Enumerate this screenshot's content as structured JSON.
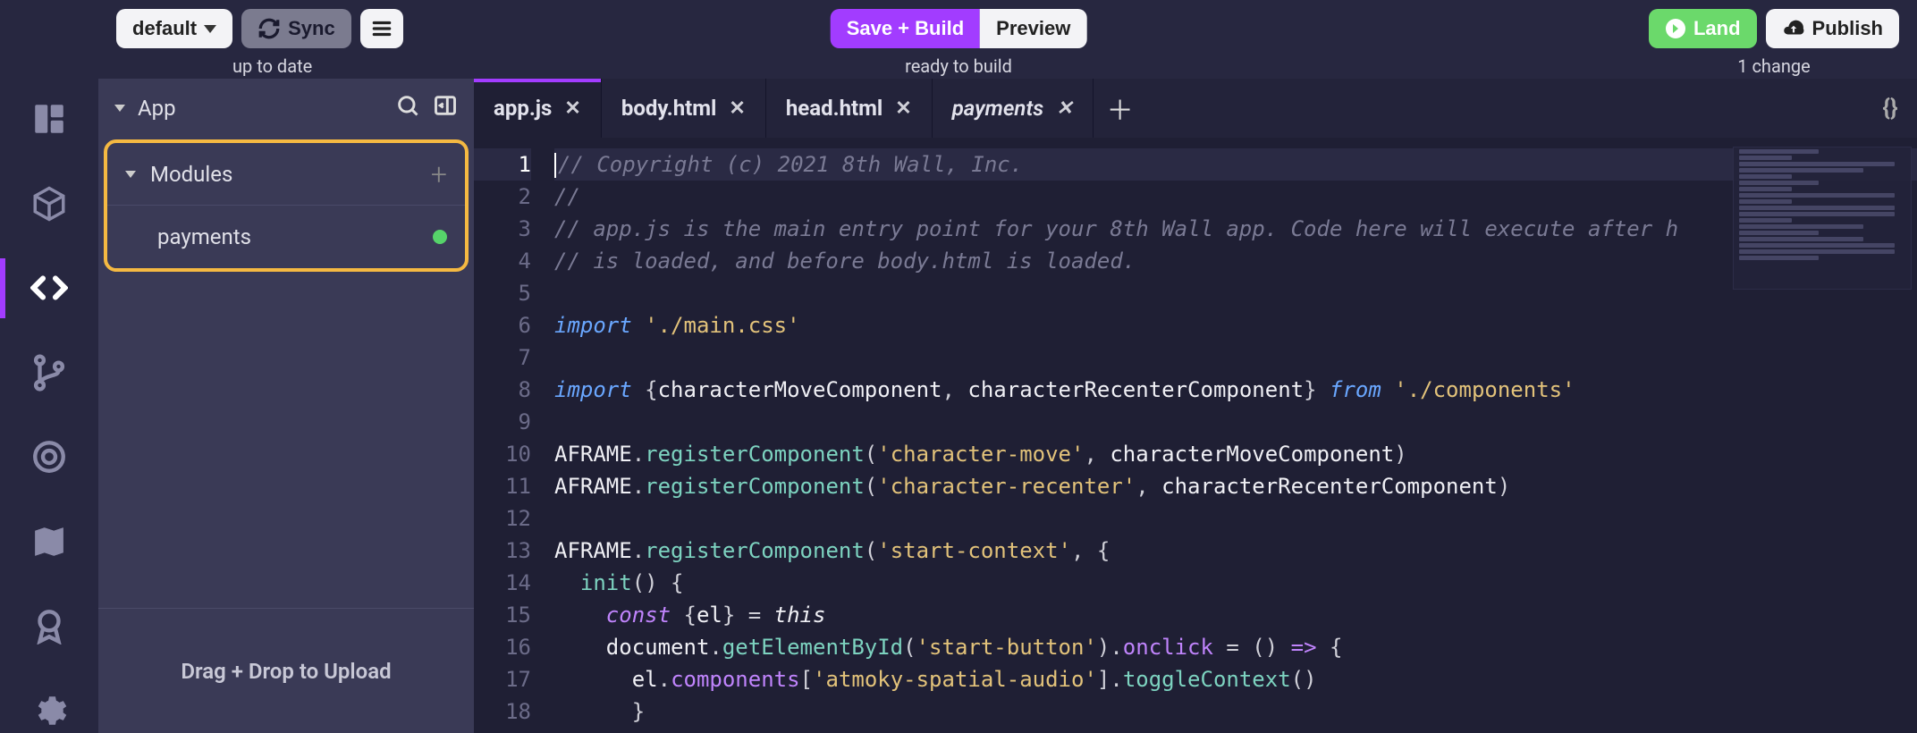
{
  "topbar": {
    "branch_label": "default",
    "sync_label": "Sync",
    "sync_status": "up to date",
    "save_build_label": "Save + Build",
    "preview_label": "Preview",
    "build_status": "ready to build",
    "land_label": "Land",
    "publish_label": "Publish",
    "changes_status": "1 change"
  },
  "rail": {
    "items": [
      {
        "name": "layout-icon"
      },
      {
        "name": "cube-icon"
      },
      {
        "name": "code-icon"
      },
      {
        "name": "branch-icon"
      },
      {
        "name": "target-icon"
      },
      {
        "name": "map-icon"
      },
      {
        "name": "award-icon"
      },
      {
        "name": "gear-icon"
      }
    ],
    "active_index": 2
  },
  "filepanel": {
    "root_label": "App",
    "section_label": "Modules",
    "items": [
      {
        "label": "payments",
        "status": "modified"
      }
    ],
    "drop_hint": "Drag + Drop to Upload"
  },
  "tabs": {
    "items": [
      {
        "label": "app.js",
        "active": true,
        "italic": false
      },
      {
        "label": "body.html",
        "active": false,
        "italic": false
      },
      {
        "label": "head.html",
        "active": false,
        "italic": false
      },
      {
        "label": "payments",
        "active": false,
        "italic": true
      }
    ]
  },
  "editor": {
    "active_line": 1,
    "lines": [
      {
        "n": 1,
        "tokens": [
          {
            "t": "comment",
            "v": "// Copyright (c) 2021 8th Wall, Inc."
          }
        ]
      },
      {
        "n": 2,
        "tokens": [
          {
            "t": "comment",
            "v": "//"
          }
        ]
      },
      {
        "n": 3,
        "tokens": [
          {
            "t": "comment",
            "v": "// app.js is the main entry point for your 8th Wall app. Code here will execute after h"
          }
        ]
      },
      {
        "n": 4,
        "tokens": [
          {
            "t": "comment",
            "v": "// is loaded, and before body.html is loaded."
          }
        ]
      },
      {
        "n": 5,
        "tokens": []
      },
      {
        "n": 6,
        "tokens": [
          {
            "t": "kw",
            "v": "import"
          },
          {
            "t": "punc",
            "v": " "
          },
          {
            "t": "str",
            "v": "'./main.css'"
          }
        ]
      },
      {
        "n": 7,
        "tokens": []
      },
      {
        "n": 8,
        "tokens": [
          {
            "t": "kw",
            "v": "import"
          },
          {
            "t": "punc",
            "v": " {"
          },
          {
            "t": "ident",
            "v": "characterMoveComponent"
          },
          {
            "t": "punc",
            "v": ", "
          },
          {
            "t": "ident",
            "v": "characterRecenterComponent"
          },
          {
            "t": "punc",
            "v": "} "
          },
          {
            "t": "kw",
            "v": "from"
          },
          {
            "t": "punc",
            "v": " "
          },
          {
            "t": "str",
            "v": "'./components'"
          }
        ]
      },
      {
        "n": 9,
        "tokens": []
      },
      {
        "n": 10,
        "tokens": [
          {
            "t": "type",
            "v": "AFRAME"
          },
          {
            "t": "punc",
            "v": "."
          },
          {
            "t": "func",
            "v": "registerComponent"
          },
          {
            "t": "punc",
            "v": "("
          },
          {
            "t": "str",
            "v": "'character-move'"
          },
          {
            "t": "punc",
            "v": ", "
          },
          {
            "t": "ident",
            "v": "characterMoveComponent"
          },
          {
            "t": "punc",
            "v": ")"
          }
        ]
      },
      {
        "n": 11,
        "tokens": [
          {
            "t": "type",
            "v": "AFRAME"
          },
          {
            "t": "punc",
            "v": "."
          },
          {
            "t": "func",
            "v": "registerComponent"
          },
          {
            "t": "punc",
            "v": "("
          },
          {
            "t": "str",
            "v": "'character-recenter'"
          },
          {
            "t": "punc",
            "v": ", "
          },
          {
            "t": "ident",
            "v": "characterRecenterComponent"
          },
          {
            "t": "punc",
            "v": ")"
          }
        ]
      },
      {
        "n": 12,
        "tokens": []
      },
      {
        "n": 13,
        "tokens": [
          {
            "t": "type",
            "v": "AFRAME"
          },
          {
            "t": "punc",
            "v": "."
          },
          {
            "t": "func",
            "v": "registerComponent"
          },
          {
            "t": "punc",
            "v": "("
          },
          {
            "t": "str",
            "v": "'start-context'"
          },
          {
            "t": "punc",
            "v": ", {"
          }
        ]
      },
      {
        "n": 14,
        "tokens": [
          {
            "t": "punc",
            "v": "  "
          },
          {
            "t": "func",
            "v": "init"
          },
          {
            "t": "punc",
            "v": "() {"
          }
        ]
      },
      {
        "n": 15,
        "tokens": [
          {
            "t": "punc",
            "v": "    "
          },
          {
            "t": "const",
            "v": "const"
          },
          {
            "t": "punc",
            "v": " {"
          },
          {
            "t": "ident",
            "v": "el"
          },
          {
            "t": "punc",
            "v": "} = "
          },
          {
            "t": "this",
            "v": "this"
          }
        ]
      },
      {
        "n": 16,
        "tokens": [
          {
            "t": "punc",
            "v": "    "
          },
          {
            "t": "ident",
            "v": "document"
          },
          {
            "t": "punc",
            "v": "."
          },
          {
            "t": "func",
            "v": "getElementById"
          },
          {
            "t": "punc",
            "v": "("
          },
          {
            "t": "str",
            "v": "'start-button'"
          },
          {
            "t": "punc",
            "v": ")."
          },
          {
            "t": "prop",
            "v": "onclick"
          },
          {
            "t": "punc",
            "v": " = () "
          },
          {
            "t": "const",
            "v": "=>"
          },
          {
            "t": "punc",
            "v": " {"
          }
        ]
      },
      {
        "n": 17,
        "tokens": [
          {
            "t": "punc",
            "v": "      "
          },
          {
            "t": "ident",
            "v": "el"
          },
          {
            "t": "punc",
            "v": "."
          },
          {
            "t": "prop",
            "v": "components"
          },
          {
            "t": "punc",
            "v": "["
          },
          {
            "t": "str",
            "v": "'atmoky-spatial-audio'"
          },
          {
            "t": "punc",
            "v": "]."
          },
          {
            "t": "func",
            "v": "toggleContext"
          },
          {
            "t": "punc",
            "v": "()"
          }
        ]
      },
      {
        "n": 18,
        "tokens": [
          {
            "t": "punc",
            "v": "      }"
          }
        ]
      }
    ]
  }
}
